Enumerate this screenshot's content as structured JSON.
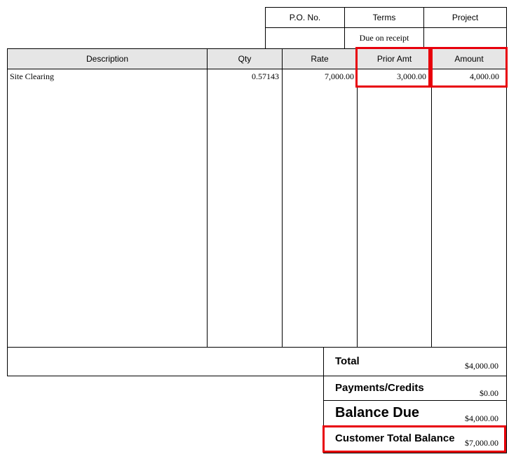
{
  "top_table": {
    "headers": [
      "P.O. No.",
      "Terms",
      "Project"
    ],
    "values": [
      "",
      "Due on receipt",
      ""
    ]
  },
  "items_table": {
    "headers": [
      "Description",
      "Qty",
      "Rate",
      "Prior Amt",
      "Amount"
    ],
    "rows": [
      [
        "Site Clearing",
        "0.57143",
        "7,000.00",
        "3,000.00",
        "4,000.00"
      ]
    ]
  },
  "totals": {
    "total_label": "Total",
    "total_value": "$4,000.00",
    "payments_label": "Payments/Credits",
    "payments_value": "$0.00",
    "balance_label": "Balance Due",
    "balance_value": "$4,000.00",
    "customer_balance_label": "Customer Total Balance",
    "customer_balance_value": "$7,000.00"
  },
  "colors": {
    "highlight": "#e8000b",
    "header_bg": "#e6e6e6"
  }
}
